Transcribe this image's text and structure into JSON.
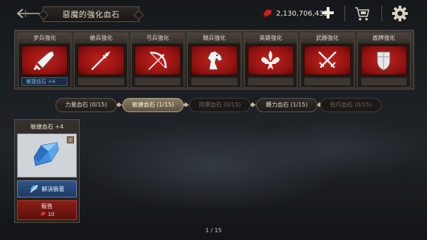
{
  "header": {
    "title": "惡魔的強化血石",
    "currency_amount": "2,130,706,432",
    "back_icon": "back-arrow-icon",
    "currency_icon": "blood-gem-icon",
    "add_icon": "plus-icon",
    "shop_icon": "shopping-cart-icon",
    "settings_icon": "gear-icon"
  },
  "enhancements": [
    {
      "label": "步兵強化",
      "icon": "sword-icon",
      "slot_text": "敏捷血石 +4",
      "selected": true
    },
    {
      "label": "槍兵強化",
      "icon": "spear-icon",
      "slot_text": "",
      "selected": false
    },
    {
      "label": "弓兵強化",
      "icon": "bow-icon",
      "slot_text": "",
      "selected": false
    },
    {
      "label": "騎兵強化",
      "icon": "horse-head-icon",
      "slot_text": "",
      "selected": false
    },
    {
      "label": "英雄強化",
      "icon": "fleur-de-lis-icon",
      "slot_text": "",
      "selected": false
    },
    {
      "label": "武器強化",
      "icon": "crossed-swords-icon",
      "slot_text": "",
      "selected": false
    },
    {
      "label": "盾牌強化",
      "icon": "shield-icon",
      "slot_text": "",
      "selected": false
    }
  ],
  "tabs": [
    {
      "label": "力量血石 (0/15)",
      "state": "normal"
    },
    {
      "label": "敏捷血石 (1/15)",
      "state": "active"
    },
    {
      "label": "防禦血石 (0/15)",
      "state": "dim"
    },
    {
      "label": "體力血石 (1/15)",
      "state": "normal"
    },
    {
      "label": "技巧血石 (0/15)",
      "state": "dim"
    }
  ],
  "item": {
    "name": "敏捷血石 +4",
    "info_label": "?",
    "unequip_label": "解決裝著",
    "sell_label": "販售",
    "sell_price": "10"
  },
  "pagination": "1 / 15",
  "colors": {
    "accent_red": "#b81d17",
    "accent_blue": "#2f5486",
    "gem_blue": "#4aa3f0"
  }
}
